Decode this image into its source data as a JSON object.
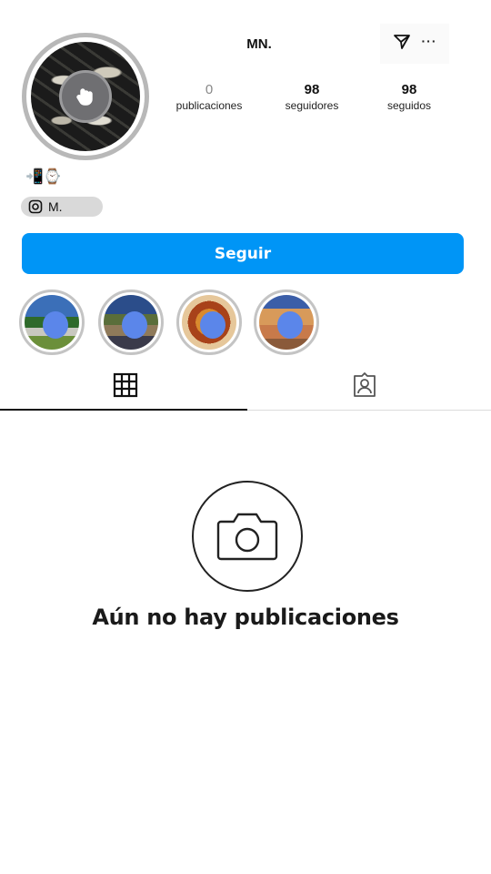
{
  "profile": {
    "username": "MN.",
    "bio_emoji": "📲⌚",
    "chip_label": "M."
  },
  "stats": {
    "posts": {
      "value": "0",
      "label": "publicaciones"
    },
    "followers": {
      "value": "98",
      "label": "seguidores"
    },
    "following": {
      "value": "98",
      "label": "seguidos"
    }
  },
  "actions": {
    "follow_label": "Seguir"
  },
  "icons": {
    "send": "send-icon",
    "more": "more-options-icon",
    "grid": "grid-icon",
    "tagged": "tagged-icon",
    "camera": "camera-icon",
    "lock_overlay": "tap-icon",
    "chip": "instagram-icon"
  },
  "highlights": [
    {
      "name": "highlight-1"
    },
    {
      "name": "highlight-2"
    },
    {
      "name": "highlight-3"
    },
    {
      "name": "highlight-4"
    }
  ],
  "empty_state": {
    "title": "Aún no hay publicaciones"
  },
  "colors": {
    "accent": "#0095f6",
    "blur_dot": "#5b86ea"
  }
}
